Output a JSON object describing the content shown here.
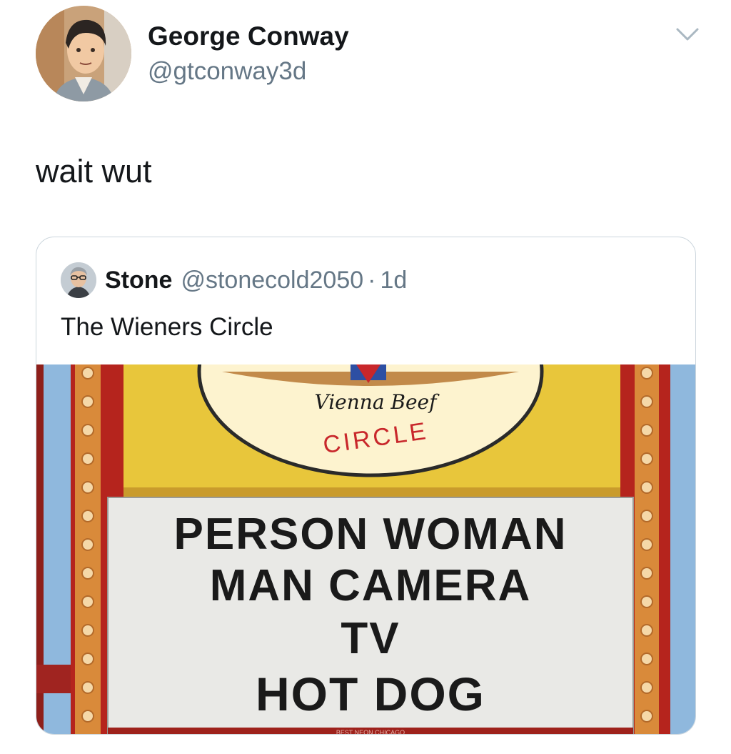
{
  "tweet": {
    "author_name": "George Conway",
    "author_handle": "@gtconway3d",
    "text": "wait wut"
  },
  "quoted_tweet": {
    "author_name": "Stone",
    "author_handle": "@stonecold2050",
    "separator": "·",
    "time": "1d",
    "text": "The Wieners Circle",
    "image": {
      "sign_brand": "Vienna Beef",
      "sign_title": "CIRCLE",
      "marquee_lines": [
        "PERSON WOMAN",
        "MAN CAMERA",
        "TV",
        "HOT DOG"
      ],
      "footer": "BEST NEON CHICAGO"
    }
  },
  "icons": {
    "menu": "chevron-down-icon"
  },
  "colors": {
    "name": "#14171a",
    "handle": "#657786",
    "border": "#ccd6dd",
    "sky": "#8fb8dd",
    "sign_yellow": "#e8c63b",
    "sign_red": "#b5241d",
    "marquee_white": "#e9e9e6"
  }
}
